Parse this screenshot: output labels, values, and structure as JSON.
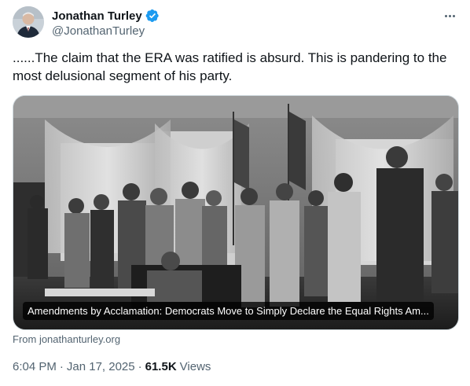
{
  "author": {
    "name": "Jonathan Turley",
    "handle": "@JonathanTurley",
    "verified": true,
    "verified_color": "#1d9bf0"
  },
  "tweet": {
    "text": "......The claim that the ERA was ratified is absurd. This is pandering to the most delusional segment of his party."
  },
  "link_card": {
    "title": "Amendments by Acclamation: Democrats Move to Simply Declare the Equal Rights Am...",
    "source": "From jonathanturley.org"
  },
  "meta": {
    "time": "6:04 PM",
    "date": "Jan 17, 2025",
    "separator": "·",
    "views_count": "61.5K",
    "views_label": "Views"
  },
  "icons": {
    "verified": "verified-badge-icon",
    "more": "more-horizontal-icon"
  },
  "colors": {
    "text_primary": "#0f1419",
    "text_secondary": "#536471",
    "border": "#cfd9de"
  }
}
